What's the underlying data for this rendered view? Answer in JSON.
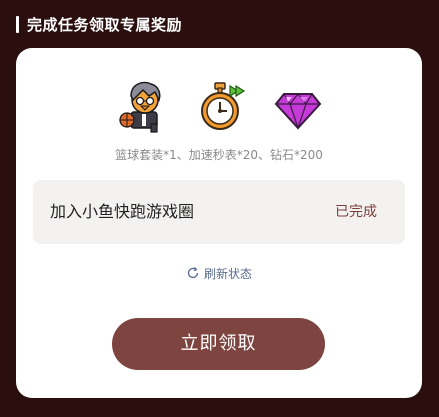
{
  "header": {
    "title": "完成任务领取专属奖励"
  },
  "rewards": {
    "icons": [
      "basketball-suit-icon",
      "stopwatch-icon",
      "diamond-icon"
    ],
    "summary": "篮球套装*1、加速秒表*20、钻石*200"
  },
  "task": {
    "name": "加入小鱼快跑游戏圈",
    "status": "已完成"
  },
  "refresh": {
    "label": "刷新状态"
  },
  "claim": {
    "label": "立即领取"
  },
  "colors": {
    "background": "#2b0f0f",
    "card": "#ffffff",
    "task_row": "#f3f2f1",
    "status_text": "#7b3f3b",
    "button": "#7e4440",
    "refresh_text": "#5a6b8c"
  }
}
